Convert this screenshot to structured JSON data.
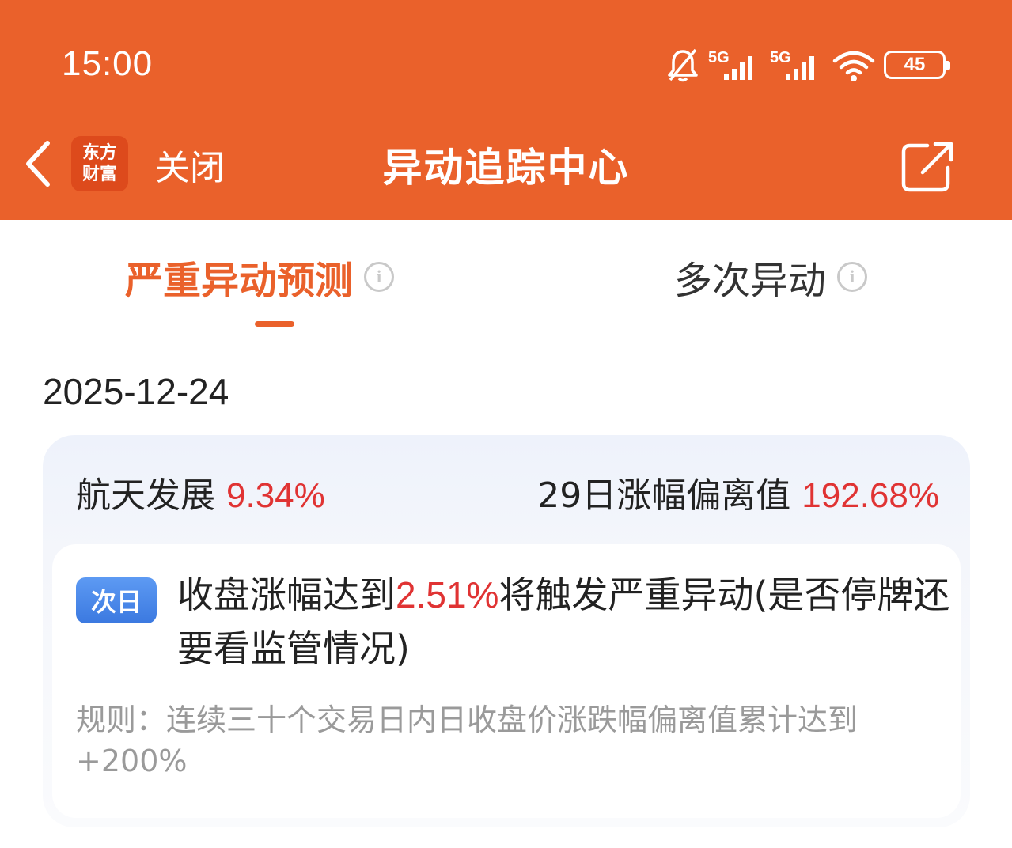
{
  "status_bar": {
    "time": "15:00",
    "icons": [
      "bell-muted-icon",
      "signal-5g-icon",
      "signal-5g-icon",
      "wifi-icon",
      "battery-icon"
    ],
    "network_label_1": "5G",
    "network_label_2": "5G",
    "battery_level": "45"
  },
  "header": {
    "back_icon": "chevron-left-icon",
    "logo_line1": "东方",
    "logo_line2": "财富",
    "close_label": "关闭",
    "title": "异动追踪中心",
    "share_icon": "share-icon"
  },
  "tabs": [
    {
      "label": "严重异动预测",
      "active": true,
      "info_icon": "info-icon"
    },
    {
      "label": "多次异动",
      "active": false,
      "info_icon": "info-icon"
    }
  ],
  "date": "2025-12-24",
  "card": {
    "stock_name": "航天发展",
    "stock_change": "9.34%",
    "deviation_label": "29日涨幅偏离值",
    "deviation_value": "192.68%",
    "badge": "次日",
    "alert_prefix": "收盘涨幅达到",
    "alert_value": "2.51%",
    "alert_suffix": "将触发严重异动(是否停牌还要看监管情况)",
    "rule": "规则：连续三十个交易日内日收盘价涨跌幅偏离值累计达到+200%"
  },
  "colors": {
    "brand": "#ea612b",
    "up": "#e03333",
    "badge": "#3b79e0"
  }
}
